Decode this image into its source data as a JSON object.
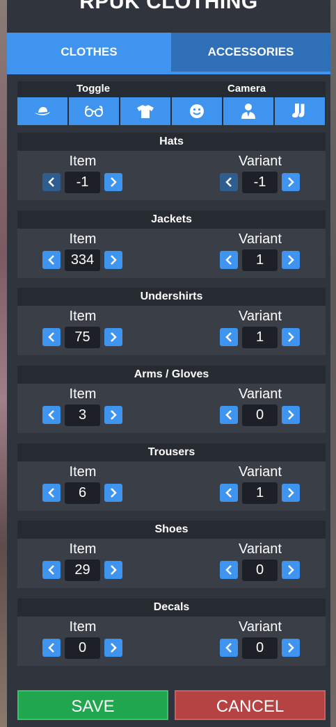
{
  "title": "RPUK CLOTHING",
  "tabs": {
    "clothes": "CLOTHES",
    "accessories": "ACCESSORIES"
  },
  "toggle": {
    "toggle_label": "Toggle",
    "camera_label": "Camera",
    "icons": [
      "hat-icon",
      "glasses-icon",
      "shirt-icon",
      "face-icon",
      "user-suit-icon",
      "socks-icon"
    ]
  },
  "labels": {
    "item": "Item",
    "variant": "Variant"
  },
  "sections": [
    {
      "name": "Hats",
      "item": "-1",
      "variant": "-1"
    },
    {
      "name": "Jackets",
      "item": "334",
      "variant": "1"
    },
    {
      "name": "Undershirts",
      "item": "75",
      "variant": "1"
    },
    {
      "name": "Arms / Gloves",
      "item": "3",
      "variant": "0"
    },
    {
      "name": "Trousers",
      "item": "6",
      "variant": "1"
    },
    {
      "name": "Shoes",
      "item": "29",
      "variant": "0"
    },
    {
      "name": "Decals",
      "item": "0",
      "variant": "0"
    }
  ],
  "buttons": {
    "save": "SAVE",
    "cancel": "CANCEL"
  },
  "colors": {
    "accent": "#3f94f0",
    "panel": "#30353d",
    "save": "#1fa64e",
    "cancel": "#b54343"
  }
}
